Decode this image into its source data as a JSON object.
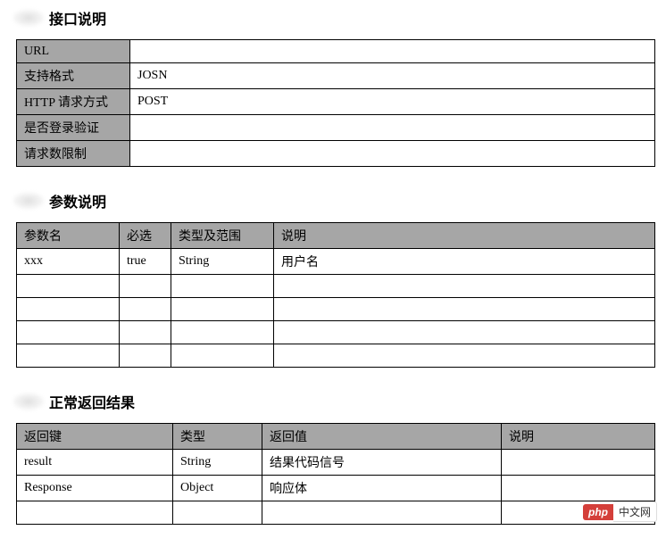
{
  "sections": {
    "api": {
      "title": "接口说明",
      "rows": [
        {
          "label": "URL",
          "value": ""
        },
        {
          "label": "支持格式",
          "value": "JOSN"
        },
        {
          "label": "HTTP 请求方式",
          "value": "POST"
        },
        {
          "label": "是否登录验证",
          "value": ""
        },
        {
          "label": "请求数限制",
          "value": ""
        }
      ]
    },
    "params": {
      "title": "参数说明",
      "headers": [
        "参数名",
        "必选",
        "类型及范围",
        "说明"
      ],
      "rows": [
        {
          "name": "xxx",
          "required": "true",
          "type": "String",
          "desc": "用户名"
        },
        {
          "name": "",
          "required": "",
          "type": "",
          "desc": ""
        },
        {
          "name": "",
          "required": "",
          "type": "",
          "desc": ""
        },
        {
          "name": "",
          "required": "",
          "type": "",
          "desc": ""
        },
        {
          "name": "",
          "required": "",
          "type": "",
          "desc": ""
        }
      ]
    },
    "response": {
      "title": "正常返回结果",
      "headers": [
        "返回键",
        "类型",
        "返回值",
        "说明"
      ],
      "rows": [
        {
          "key": "result",
          "type": "String",
          "value": "结果代码信号",
          "desc": ""
        },
        {
          "key": "Response",
          "type": "Object",
          "value": "响应体",
          "desc": ""
        },
        {
          "key": "",
          "type": "",
          "value": "",
          "desc": ""
        }
      ]
    }
  },
  "watermark": {
    "badge": "php",
    "text": "中文网"
  }
}
